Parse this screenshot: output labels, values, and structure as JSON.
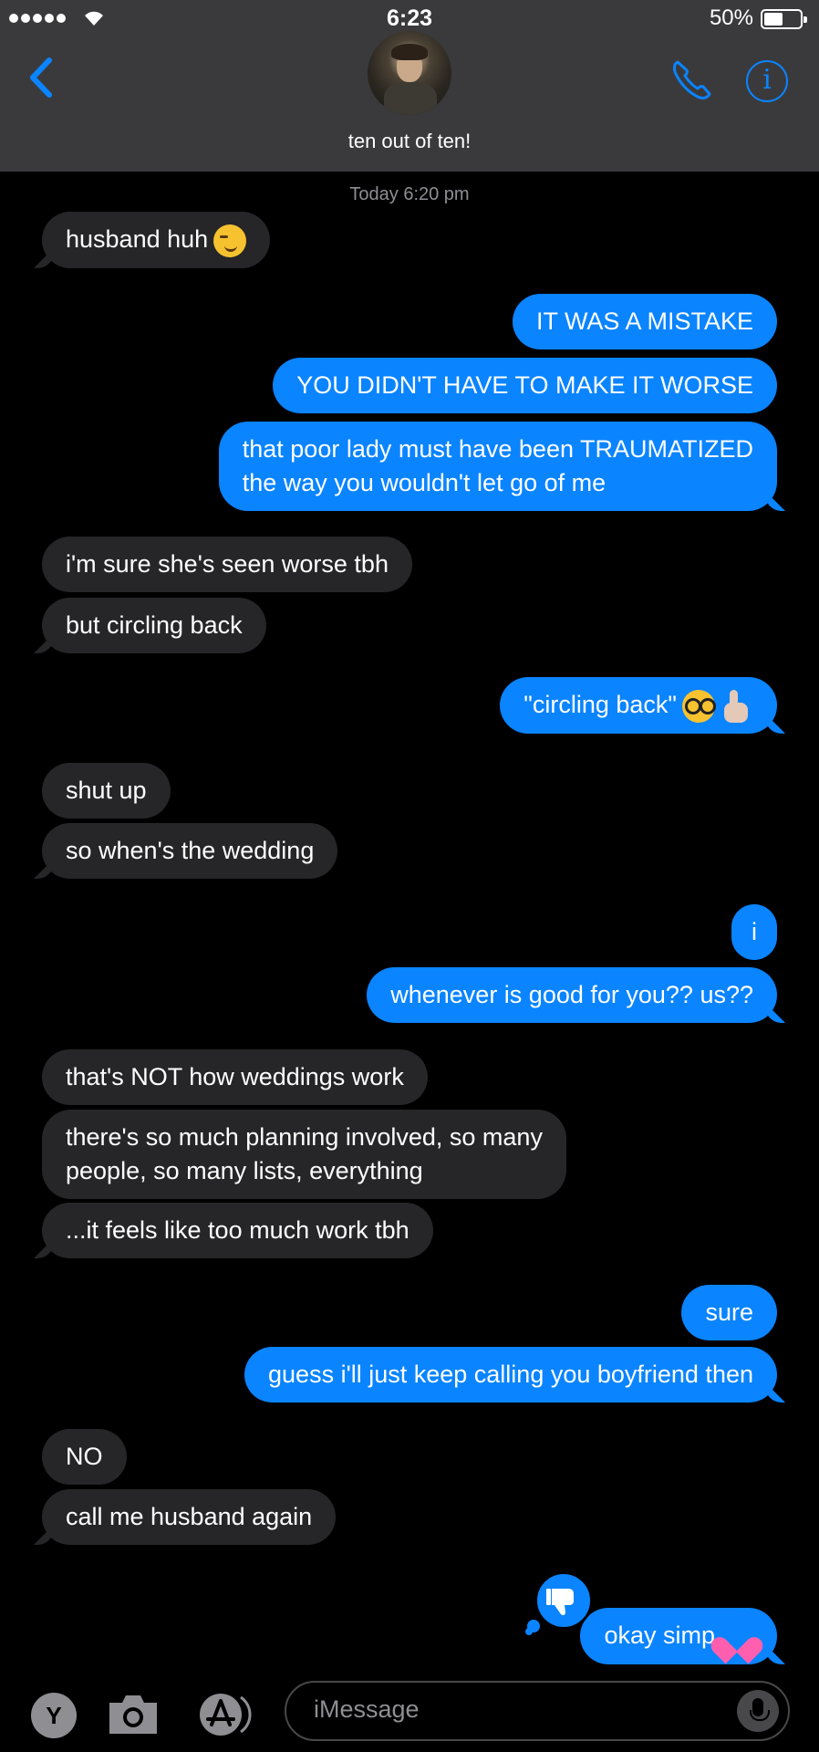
{
  "status_bar": {
    "time": "6:23",
    "battery": "50%"
  },
  "header": {
    "contact_name": "ten out of ten!"
  },
  "thread": {
    "timestamp": "Today 6:20 pm",
    "messages": [
      {
        "from": "them",
        "text": "husband huh",
        "emoji": "smirk-emoji"
      },
      {
        "from": "me",
        "text": "IT WAS A MISTAKE"
      },
      {
        "from": "me",
        "text": "YOU DIDN'T HAVE TO MAKE IT WORSE"
      },
      {
        "from": "me",
        "line1": "that poor lady must have been TRAUMATIZED",
        "line2": "the way you wouldn't let go of me"
      },
      {
        "from": "them",
        "text": "i'm sure she's seen worse tbh"
      },
      {
        "from": "them",
        "text": "but circling back"
      },
      {
        "from": "me",
        "text": "\"circling back\"",
        "emoji": "nerd-face-emoji, pointing-up-emoji"
      },
      {
        "from": "them",
        "text": "shut up"
      },
      {
        "from": "them",
        "text": "so when's the wedding"
      },
      {
        "from": "me",
        "text": "i"
      },
      {
        "from": "me",
        "text": "whenever is good for you?? us??"
      },
      {
        "from": "them",
        "text": "that's NOT how weddings work"
      },
      {
        "from": "them",
        "line1": "there's so much planning involved, so many",
        "line2": "people, so many lists, everything"
      },
      {
        "from": "them",
        "text": "...it feels like too much work tbh"
      },
      {
        "from": "me",
        "text": "sure"
      },
      {
        "from": "me",
        "text": "guess i'll just keep calling you boyfriend then"
      },
      {
        "from": "them",
        "text": "NO"
      },
      {
        "from": "them",
        "text": "call me husband again"
      },
      {
        "from": "me",
        "text": "okay simp",
        "emoji": "heart-emoji",
        "reaction": "thumbs-down-icon"
      }
    ]
  },
  "compose": {
    "app_drawer_label": "Y",
    "placeholder": "iMessage"
  },
  "colors": {
    "header_bg": "#3a3a3c",
    "sent_bubble": "#0a84ff",
    "received_bubble": "#262628",
    "accent": "#0a84ff"
  }
}
